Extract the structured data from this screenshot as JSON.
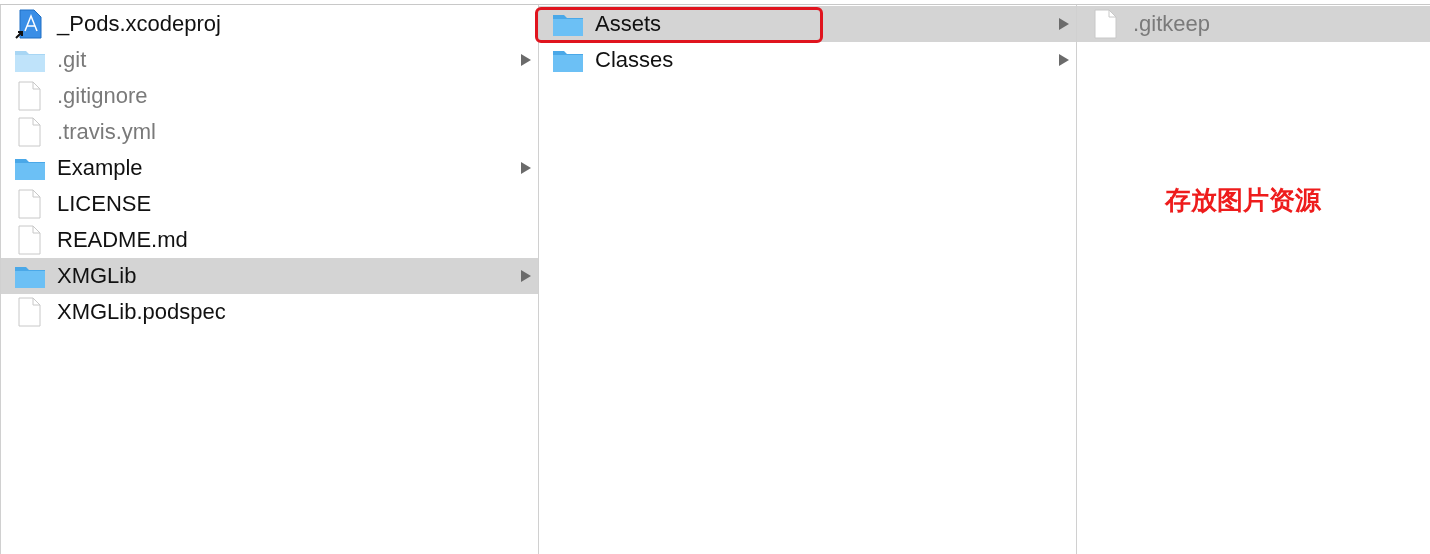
{
  "columns": [
    {
      "items": [
        {
          "name": "_Pods.xcodeproj",
          "kind": "project",
          "hidden": false,
          "selected": false,
          "has_children": false
        },
        {
          "name": ".git",
          "kind": "folder",
          "hidden": true,
          "selected": false,
          "has_children": true
        },
        {
          "name": ".gitignore",
          "kind": "file",
          "hidden": true,
          "selected": false,
          "has_children": false
        },
        {
          "name": ".travis.yml",
          "kind": "file",
          "hidden": true,
          "selected": false,
          "has_children": false
        },
        {
          "name": "Example",
          "kind": "folder",
          "hidden": false,
          "selected": false,
          "has_children": true
        },
        {
          "name": "LICENSE",
          "kind": "file",
          "hidden": false,
          "selected": false,
          "has_children": false
        },
        {
          "name": "README.md",
          "kind": "file",
          "hidden": false,
          "selected": false,
          "has_children": false
        },
        {
          "name": "XMGLib",
          "kind": "folder",
          "hidden": false,
          "selected": true,
          "has_children": true
        },
        {
          "name": "XMGLib.podspec",
          "kind": "file",
          "hidden": false,
          "selected": false,
          "has_children": false
        }
      ]
    },
    {
      "items": [
        {
          "name": "Assets",
          "kind": "folder",
          "hidden": false,
          "selected": true,
          "has_children": true,
          "highlighted": true
        },
        {
          "name": "Classes",
          "kind": "folder",
          "hidden": false,
          "selected": false,
          "has_children": true,
          "highlighted": false
        }
      ]
    },
    {
      "items": [
        {
          "name": ".gitkeep",
          "kind": "file",
          "hidden": true,
          "selected": true,
          "has_children": false
        }
      ],
      "annotation": "存放图片资源"
    }
  ]
}
